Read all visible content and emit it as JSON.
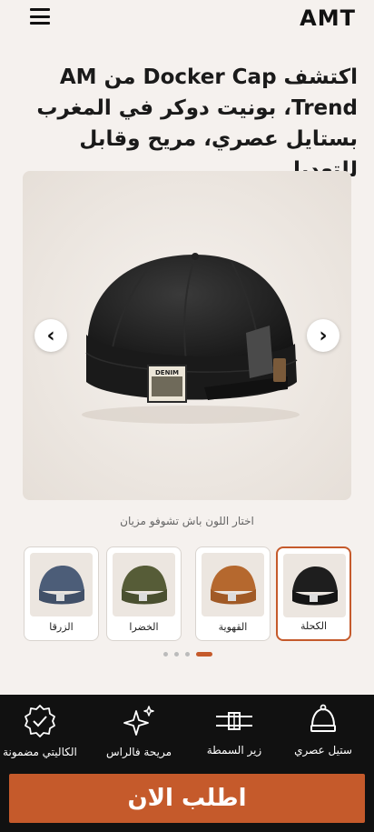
{
  "header": {
    "logo": "AMT",
    "menu_icon": "hamburger-menu-icon"
  },
  "headline": "اكتشف Docker Cap من AM Trend، بونيت دوكر في المغرب بستايل عصري، مريح وقابل للتعديل.",
  "gallery": {
    "prev_icon": "chevron-left-icon",
    "next_icon": "chevron-right-icon",
    "prev_glyph": "‹",
    "next_glyph": "›",
    "product_image": "black-docker-cap-photo",
    "patch_text": "DENIM"
  },
  "color_hint": "اختار اللون باش تشوفو مزيان",
  "colors": [
    {
      "label": "الكحلة",
      "hex": "#1e1e1e",
      "selected": true
    },
    {
      "label": "القهوية",
      "hex": "#b5682e",
      "selected": false
    },
    {
      "label": "الخضرا",
      "hex": "#565c37",
      "selected": false
    },
    {
      "label": "الزرقا",
      "hex": "#4c5d78",
      "selected": false
    }
  ],
  "carousel": {
    "total": 4,
    "active": 1
  },
  "features": [
    {
      "label": "ستيل عصري",
      "icon": "beanie-icon"
    },
    {
      "label": "زير السمطة",
      "icon": "adjustable-strap-icon"
    },
    {
      "label": "مريحة فالراس",
      "icon": "sparkles-icon"
    },
    {
      "label": "الكاليتي مضمونة",
      "icon": "quality-badge-icon"
    }
  ],
  "cta": {
    "label": "اطلب الان"
  },
  "colors_theme": {
    "accent": "#c55a2b",
    "dark": "#111111",
    "background": "#f5f1ee"
  }
}
